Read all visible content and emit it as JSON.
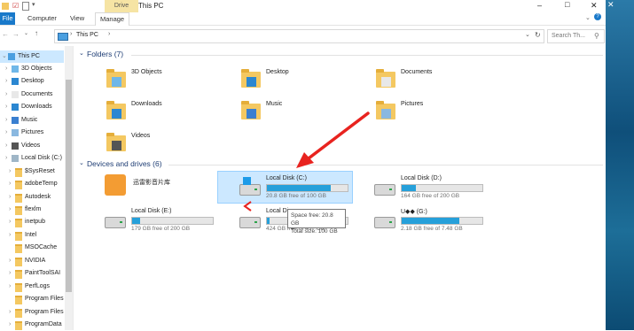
{
  "window": {
    "title": "This PC",
    "context_tab": "Drive Tools",
    "min": "–",
    "max": "□",
    "close": "✕"
  },
  "ribbon": {
    "tabs": [
      "File",
      "Computer",
      "View",
      "Manage"
    ]
  },
  "address": {
    "path_root": "This PC",
    "sep": "›",
    "search_placeholder": "Search Th..."
  },
  "nav": {
    "items": [
      {
        "label": "This PC",
        "icon": "pc-icon",
        "selected": true
      },
      {
        "label": "3D Objects",
        "icon": "3d-objects-icon"
      },
      {
        "label": "Desktop",
        "icon": "desktop-icon"
      },
      {
        "label": "Documents",
        "icon": "documents-icon"
      },
      {
        "label": "Downloads",
        "icon": "downloads-icon"
      },
      {
        "label": "Music",
        "icon": "music-icon"
      },
      {
        "label": "Pictures",
        "icon": "pictures-icon"
      },
      {
        "label": "Videos",
        "icon": "videos-icon"
      },
      {
        "label": "Local Disk (C:)",
        "icon": "drive-icon"
      },
      {
        "label": "$SysReset",
        "icon": "folder-icon"
      },
      {
        "label": "adobeTemp",
        "icon": "folder-icon"
      },
      {
        "label": "Autodesk",
        "icon": "folder-icon"
      },
      {
        "label": "flexlm",
        "icon": "folder-icon"
      },
      {
        "label": "inetpub",
        "icon": "folder-icon"
      },
      {
        "label": "Intel",
        "icon": "folder-icon"
      },
      {
        "label": "MSOCache",
        "icon": "folder-icon"
      },
      {
        "label": "NVIDIA",
        "icon": "folder-icon"
      },
      {
        "label": "PaintToolSAI",
        "icon": "folder-icon"
      },
      {
        "label": "PerfLogs",
        "icon": "folder-icon"
      },
      {
        "label": "Program Files",
        "icon": "folder-icon"
      },
      {
        "label": "Program Files (",
        "icon": "folder-icon"
      },
      {
        "label": "ProgramData",
        "icon": "folder-icon"
      }
    ]
  },
  "folders": {
    "heading": "Folders (7)",
    "items": [
      "3D Objects",
      "Desktop",
      "Documents",
      "Downloads",
      "Music",
      "Pictures",
      "Videos"
    ]
  },
  "drives": {
    "heading": "Devices and drives (6)",
    "items": [
      {
        "name": "迅雷影音片库",
        "free_text": "",
        "used_fraction": null
      },
      {
        "name": "Local Disk (C:)",
        "free_text": "20.8 GB free of 100 GB",
        "used_fraction": 0.79
      },
      {
        "name": "Local Disk (D:)",
        "free_text": "164 GB free of 200 GB",
        "used_fraction": 0.18
      },
      {
        "name": "Local Disk (E:)",
        "free_text": "179 GB free of 200 GB",
        "used_fraction": 0.1
      },
      {
        "name": "Local Di",
        "free_text": "424 GB free of 437 GB",
        "used_fraction": 0.03
      },
      {
        "name": "U◆◆ (G:)",
        "free_text": "2.18 GB free of 7.48 GB",
        "used_fraction": 0.71
      }
    ]
  },
  "tooltip": {
    "line1": "Space free: 20.8 GB",
    "line2": "Total size: 100 GB"
  },
  "colors": {
    "accent": "#1979ca",
    "bar_fill": "#26a0da",
    "annotation_arrow": "#e8231f"
  }
}
